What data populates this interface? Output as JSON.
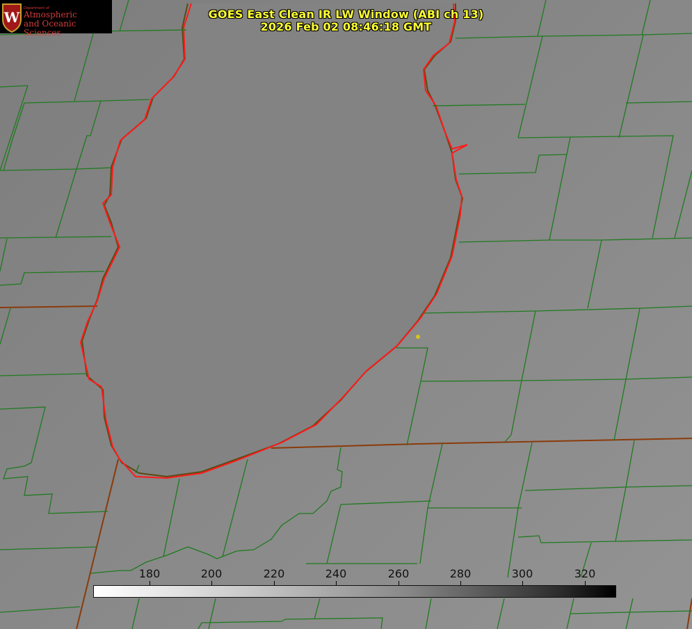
{
  "title": {
    "line1": "GOES East Clean IR LW Window (ABI ch 13)",
    "line2": "2026 Feb 02 08:46:18 GMT"
  },
  "logo": {
    "small_text": "Department of",
    "line1": "Atmospheric",
    "line2": "and Oceanic Sciences",
    "emblem_letter": "W",
    "icon": "uw-crest-icon"
  },
  "colorbar": {
    "ticks": [
      "180",
      "200",
      "220",
      "240",
      "260",
      "280",
      "300",
      "320"
    ]
  },
  "colors": {
    "county_lines": "#1f7a1f",
    "state_lines": "#8b3a0a",
    "lake_outline": "#ff1a1a",
    "title_text": "#ffff33",
    "point_marker": "#d9c41a"
  }
}
